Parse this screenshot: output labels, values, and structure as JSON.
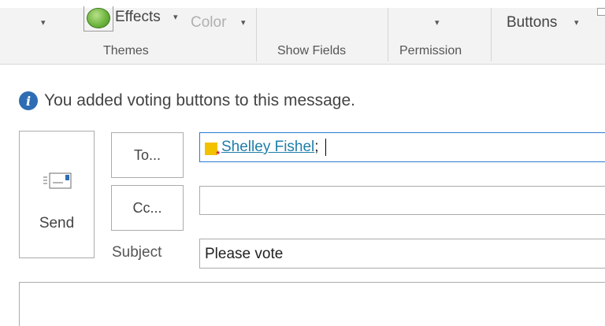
{
  "ribbon": {
    "effects_label": "Effects",
    "color_label": "Color",
    "buttons_label": "Buttons",
    "caret": "▾",
    "groups": {
      "themes": "Themes",
      "show_fields": "Show Fields",
      "permission": "Permission"
    }
  },
  "info_bar": {
    "icon": "info-icon",
    "message": "You added voting buttons to this message."
  },
  "compose": {
    "send_label": "Send",
    "to_button": "To...",
    "cc_button": "Cc...",
    "subject_label": "Subject",
    "to_recipient": "Shelley Fishel",
    "to_separator": ";",
    "cc_value": "",
    "subject_value": "Please vote"
  },
  "colors": {
    "accent": "#2b7bd1",
    "info_icon": "#2e6db3",
    "link": "#1f7ea8"
  }
}
